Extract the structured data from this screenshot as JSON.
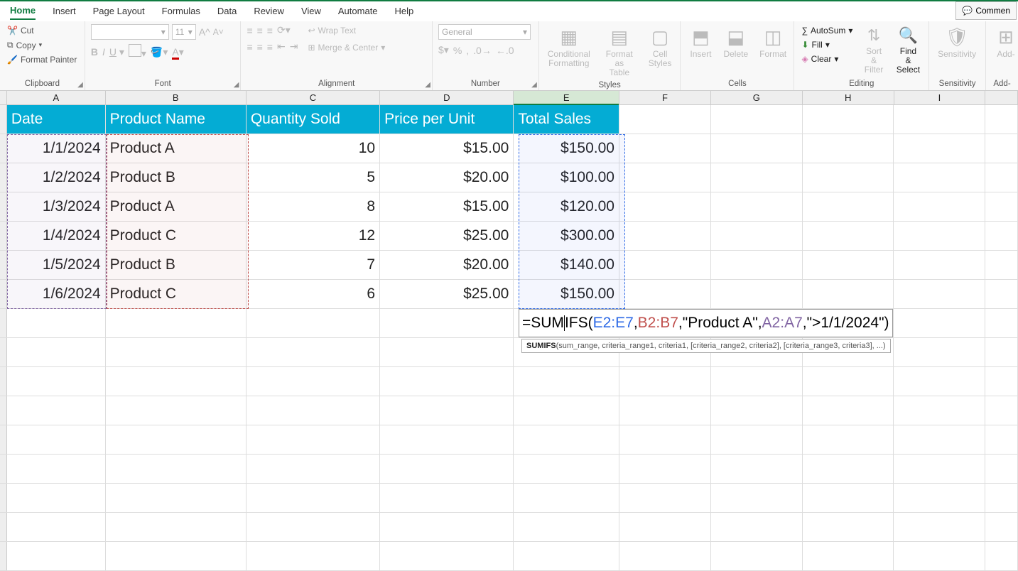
{
  "tabs": [
    "Home",
    "Insert",
    "Page Layout",
    "Formulas",
    "Data",
    "Review",
    "View",
    "Automate",
    "Help"
  ],
  "active_tab": "Home",
  "comments_label": "Commen",
  "clipboard": {
    "cut": "Cut",
    "copy": "Copy",
    "paint": "Format Painter",
    "label": "Clipboard"
  },
  "font": {
    "name": "",
    "size": "11",
    "label": "Font"
  },
  "alignment": {
    "wrap": "Wrap Text",
    "merge": "Merge & Center",
    "label": "Alignment"
  },
  "number": {
    "format": "General",
    "label": "Number"
  },
  "styles": {
    "cond": "Conditional\nFormatting",
    "table": "Format as\nTable",
    "cell": "Cell\nStyles",
    "label": "Styles"
  },
  "cells": {
    "insert": "Insert",
    "delete": "Delete",
    "format": "Format",
    "label": "Cells"
  },
  "editing": {
    "autosum": "AutoSum",
    "fill": "Fill",
    "clear": "Clear",
    "sort": "Sort &\nFilter",
    "find": "Find &\nSelect",
    "label": "Editing"
  },
  "sensitivity": {
    "btn": "Sensitivity",
    "label": "Sensitivity"
  },
  "addins": {
    "btn": "Add-",
    "label": "Add-"
  },
  "columns": [
    "A",
    "B",
    "C",
    "D",
    "E",
    "F",
    "G",
    "H",
    "I",
    ""
  ],
  "selected_col": "E",
  "headers": [
    "Date",
    "Product Name",
    "Quantity Sold",
    "Price per Unit",
    "Total Sales"
  ],
  "rows": [
    {
      "date": "1/1/2024",
      "name": "Product A",
      "qty": "10",
      "price": "$15.00",
      "total": "$150.00"
    },
    {
      "date": "1/2/2024",
      "name": "Product B",
      "qty": "5",
      "price": "$20.00",
      "total": "$100.00"
    },
    {
      "date": "1/3/2024",
      "name": "Product A",
      "qty": "8",
      "price": "$15.00",
      "total": "$120.00"
    },
    {
      "date": "1/4/2024",
      "name": "Product C",
      "qty": "12",
      "price": "$25.00",
      "total": "$300.00"
    },
    {
      "date": "1/5/2024",
      "name": "Product B",
      "qty": "7",
      "price": "$20.00",
      "total": "$140.00"
    },
    {
      "date": "1/6/2024",
      "name": "Product C",
      "qty": "6",
      "price": "$25.00",
      "total": "$150.00"
    }
  ],
  "formula": {
    "prefix": "=SUM",
    "fn": "IFS(",
    "arg1": "E2:E7",
    "sep": ", ",
    "arg2": "B2:B7",
    "arg3": "\"Product A\"",
    "arg4": "A2:A7",
    "arg5": "\">1/1/2024\"",
    "close": ")"
  },
  "tooltip": {
    "fn": "SUMIFS",
    "sig": "(sum_range, criteria_range1, criteria1, [criteria_range2, criteria2], [criteria_range3, criteria3], ...)"
  }
}
